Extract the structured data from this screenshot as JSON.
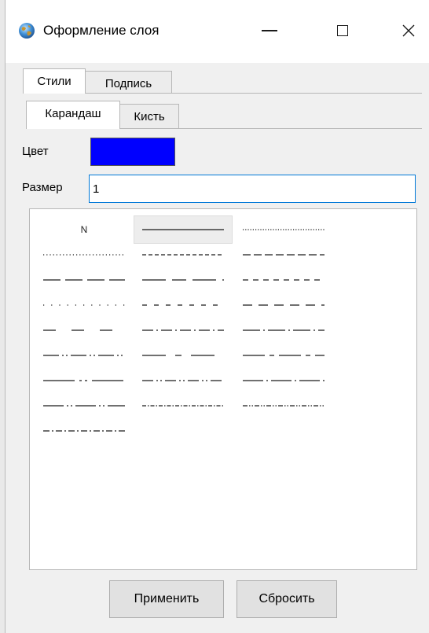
{
  "window": {
    "title": "Оформление слоя",
    "icon": "globe-icon",
    "controls": [
      "minimize-icon",
      "maximize-icon",
      "close-icon"
    ]
  },
  "tabs_main": [
    {
      "label": "Стили",
      "active": true
    },
    {
      "label": "Подпись",
      "active": false
    }
  ],
  "tabs_sub": [
    {
      "label": "Карандаш",
      "active": true
    },
    {
      "label": "Кисть",
      "active": false
    }
  ],
  "form": {
    "color_label": "Цвет",
    "color_value": "#0000ff",
    "size_label": "Размер",
    "size_value": "1"
  },
  "line_styles": {
    "none_label": "N",
    "selected_index": 1,
    "items": [
      "none",
      "solid",
      "dot-dense",
      "dot",
      "dash-short",
      "dash-medium",
      "dash-long",
      "long-short",
      "dash-gap",
      "dot-sparse",
      "dash-small",
      "dash-wide",
      "long-gap",
      "dash-dot",
      "long-dot",
      "long-dash-dot-dot",
      "long-short-long",
      "long-dash-dot",
      "long-dash-dot-pair",
      "dash-dot-dot",
      "long-dot-long",
      "long-dot-dot-long",
      "dash-dot-fine",
      "dash-dot-dot-fine",
      "dash-dot-short"
    ]
  },
  "buttons": {
    "apply": "Применить",
    "reset": "Сбросить"
  }
}
